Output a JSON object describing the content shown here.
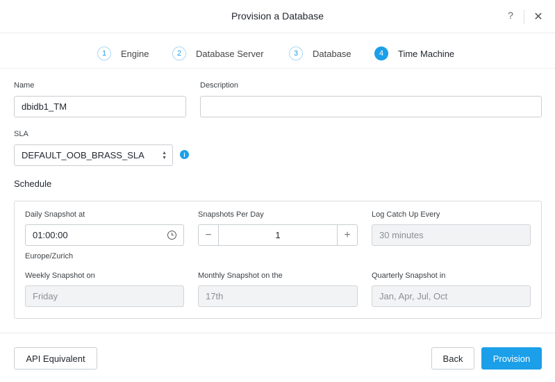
{
  "header": {
    "title": "Provision a Database",
    "help": "?",
    "close": "✕"
  },
  "steps": [
    {
      "num": "1",
      "label": "Engine"
    },
    {
      "num": "2",
      "label": "Database Server"
    },
    {
      "num": "3",
      "label": "Database"
    },
    {
      "num": "4",
      "label": "Time Machine"
    }
  ],
  "active_step": "Time Machine",
  "form": {
    "name_label": "Name",
    "name_value": "dbidb1_TM",
    "description_label": "Description",
    "description_value": "",
    "sla_label": "SLA",
    "sla_value": "DEFAULT_OOB_BRASS_SLA",
    "sla_arrows": "▲▼"
  },
  "schedule": {
    "title": "Schedule",
    "daily_label": "Daily Snapshot at",
    "daily_value": "01:00:00",
    "timezone": "Europe/Zurich",
    "per_day_label": "Snapshots Per Day",
    "per_day_value": "1",
    "minus": "−",
    "plus": "+",
    "log_label": "Log Catch Up Every",
    "log_value": "30 minutes",
    "weekly_label": "Weekly Snapshot on",
    "weekly_value": "Friday",
    "monthly_label": "Monthly Snapshot on the",
    "monthly_value": "17th",
    "quarterly_label": "Quarterly Snapshot in",
    "quarterly_value": "Jan, Apr, Jul, Oct"
  },
  "footer": {
    "api": "API Equivalent",
    "back": "Back",
    "provision": "Provision"
  },
  "colors": {
    "accent": "#1b9fe9"
  }
}
